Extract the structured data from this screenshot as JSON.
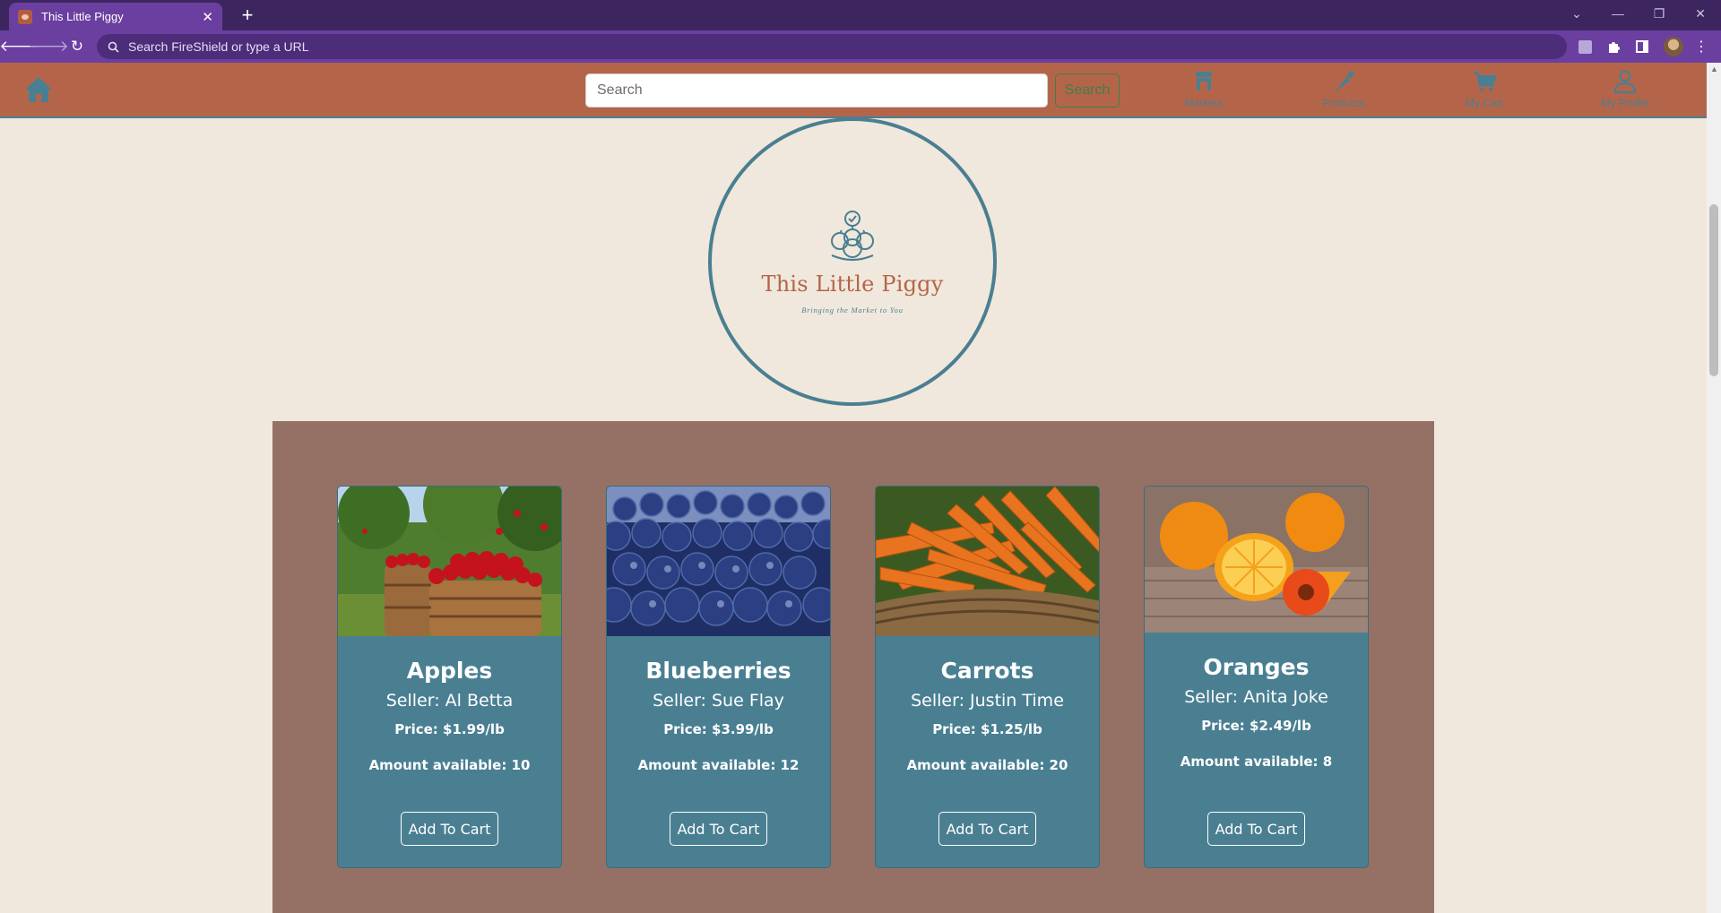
{
  "browser": {
    "tab_title": "This Little Piggy",
    "tab_close": "✕",
    "new_tab": "+",
    "omnibox_placeholder": "Search FireShield or type a URL"
  },
  "header": {
    "search_placeholder": "Search",
    "search_button": "Search",
    "nav": [
      {
        "label": "Markets",
        "icon": "market-icon"
      },
      {
        "label": "Products",
        "icon": "carrot-icon"
      },
      {
        "label": "My Cart",
        "icon": "cart-icon"
      },
      {
        "label": "My Profile",
        "icon": "profile-icon"
      }
    ]
  },
  "logo": {
    "title": "This Little Piggy",
    "tagline": "Bringing the Market to You"
  },
  "products": [
    {
      "name": "Apples",
      "seller": "Seller: Al Betta",
      "price": "Price: $1.99/lb",
      "amount": "Amount available: 10",
      "button": "Add To Cart"
    },
    {
      "name": "Blueberries",
      "seller": "Seller: Sue Flay",
      "price": "Price: $3.99/lb",
      "amount": "Amount available: 12",
      "button": "Add To Cart"
    },
    {
      "name": "Carrots",
      "seller": "Seller: Justin Time",
      "price": "Price: $1.25/lb",
      "amount": "Amount available: 20",
      "button": "Add To Cart"
    },
    {
      "name": "Oranges",
      "seller": "Seller: Anita Joke",
      "price": "Price: $2.49/lb",
      "amount": "Amount available: 8",
      "button": "Add To Cart"
    }
  ],
  "colors": {
    "header_bg": "#b46549",
    "accent_teal": "#4a7f92",
    "page_bg": "#f0e8dc",
    "products_bg": "#957165",
    "browser_purple": "#6a3fa0"
  }
}
